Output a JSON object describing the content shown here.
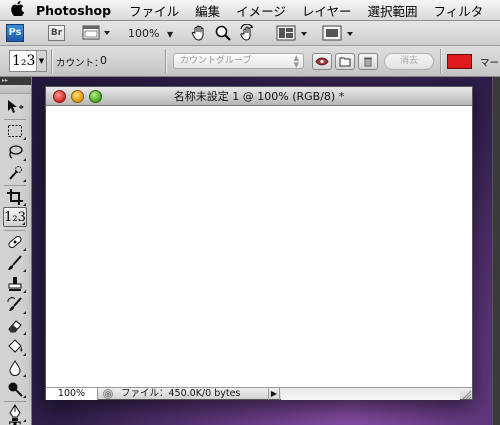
{
  "menubar": {
    "apple_icon": "apple-logo-icon",
    "app_name": "Photoshop",
    "items": [
      "ファイル",
      "編集",
      "イメージ",
      "レイヤー",
      "選択範囲",
      "フィルタ"
    ]
  },
  "appbar": {
    "ps_label": "Ps",
    "br_label": "Br",
    "zoom": "100%",
    "zoom_arrow": "▼"
  },
  "options": {
    "preset_glyph": "1₂3",
    "preset_arrow": "▼",
    "count_label": "カウント：",
    "count_value": "0",
    "group_placeholder": "カウントグループ",
    "group_stepper": "▲▼",
    "clear_label": "消去",
    "marker_color": "#e01b1b",
    "marker_label": "マーカー"
  },
  "document": {
    "title": "名称未設定 1 @ 100% (RGB/8) *",
    "zoom": "100%",
    "status_info_glyph": "◎",
    "status": "ファイル：450.0K/0 bytes",
    "status_arrow": "▶"
  },
  "tools_panel": {
    "header": "▸▸",
    "active_tool_glyph": "1₂3"
  },
  "colors": {
    "desktop": "#2e1f4a",
    "accent": "#3a8fd9"
  }
}
